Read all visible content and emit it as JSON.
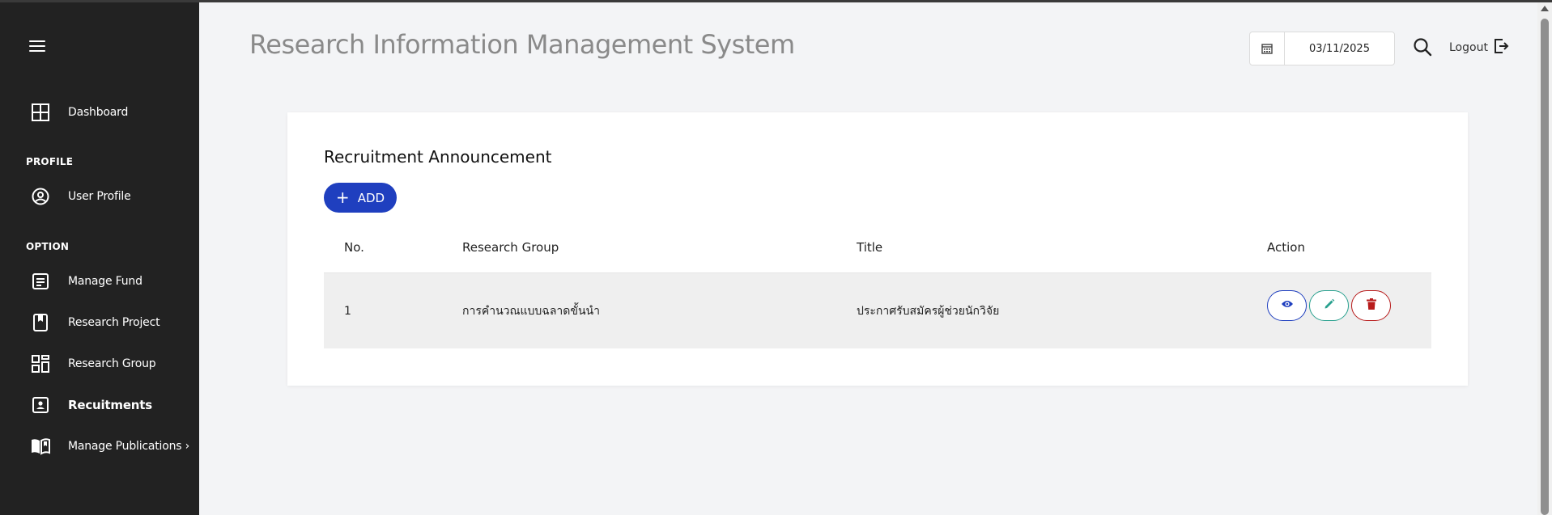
{
  "header": {
    "title": "Research Information Management System",
    "date": "03/11/2025",
    "logout_label": "Logout"
  },
  "sidebar": {
    "items": [
      {
        "label": "Dashboard",
        "icon": "dashboard-icon"
      },
      {
        "label": "User Profile",
        "icon": "user-circle-icon"
      },
      {
        "label": "Manage Fund",
        "icon": "document-list-icon"
      },
      {
        "label": "Research Project",
        "icon": "bookmark-icon"
      },
      {
        "label": "Research Group",
        "icon": "grid-icon"
      },
      {
        "label": "Recuitments",
        "icon": "person-card-icon"
      },
      {
        "label": "Manage Publications ›",
        "icon": "open-book-icon"
      }
    ],
    "sections": {
      "profile": "PROFILE",
      "option": "OPTION"
    },
    "active": "Recuitments"
  },
  "main": {
    "card_title": "Recruitment Announcement",
    "add_label": "ADD",
    "table": {
      "columns": [
        "No.",
        "Research Group",
        "Title",
        "Action"
      ],
      "rows": [
        {
          "no": "1",
          "group": "การคำนวณแบบฉลาดขั้นนำ",
          "title": "ประกาศรับสมัครผู้ช่วยนักวิจัย"
        }
      ]
    }
  },
  "colors": {
    "sidebar_bg": "#222222",
    "primary": "#1f3fbf",
    "edit": "#2aa18f",
    "delete": "#b81c1c",
    "page_bg": "#f3f4f6"
  }
}
